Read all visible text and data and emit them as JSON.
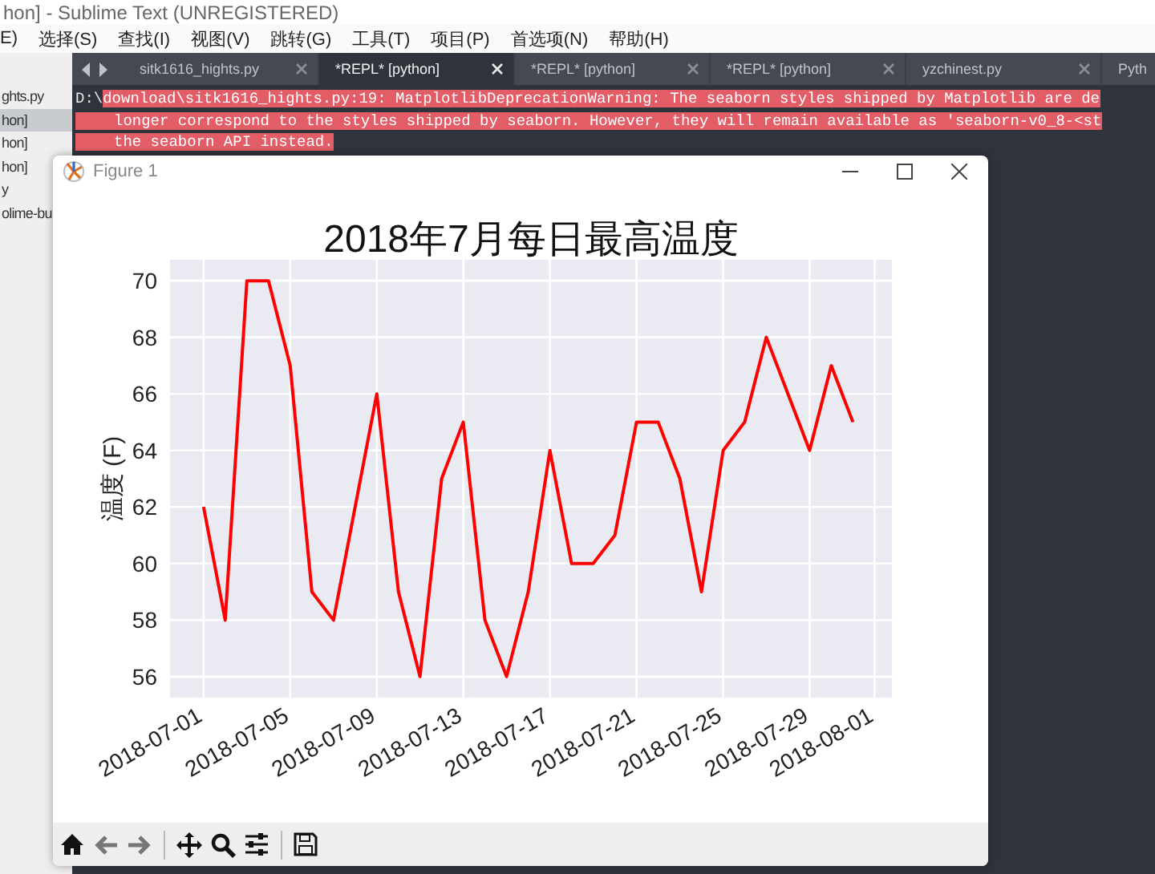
{
  "window": {
    "title": "hon] - Sublime Text (UNREGISTERED)"
  },
  "menu": [
    "E)",
    "选择(S)",
    "查找(I)",
    "视图(V)",
    "跳转(G)",
    "工具(T)",
    "项目(P)",
    "首选项(N)",
    "帮助(H)"
  ],
  "sidebar": {
    "items": [
      {
        "label": "ghts.py",
        "selected": false
      },
      {
        "label": "hon]",
        "selected": true
      },
      {
        "label": "hon]",
        "selected": false
      },
      {
        "label": "hon]",
        "selected": false
      },
      {
        "label": "y",
        "selected": false
      },
      {
        "label": "olime-bu",
        "selected": false
      }
    ]
  },
  "tabs": [
    {
      "label": "sitk1616_hights.py",
      "selected": false
    },
    {
      "label": "*REPL* [python]",
      "selected": true
    },
    {
      "label": "*REPL* [python]",
      "selected": false
    },
    {
      "label": "*REPL* [python]",
      "selected": false
    },
    {
      "label": "yzchinest.py",
      "selected": false
    },
    {
      "label": "Pyth",
      "selected": false
    }
  ],
  "console": {
    "prefix": "D:\\",
    "lines": [
      "download\\sitk1616_hights.py:19: MatplotlibDeprecationWarning: The seaborn styles shipped by Matplotlib are de",
      "longer correspond to the styles shipped by seaborn. However, they will remain available as 'seaborn-v0_8-<st",
      "the seaborn API instead."
    ]
  },
  "figure": {
    "title": "Figure 1",
    "chart_data": {
      "type": "line",
      "title": "2018年7月每日最高温度",
      "ylabel": "温度 (F)",
      "categories": [
        "2018-07-01",
        null,
        null,
        null,
        "2018-07-05",
        null,
        null,
        null,
        "2018-07-09",
        null,
        null,
        null,
        "2018-07-13",
        null,
        null,
        null,
        "2018-07-17",
        null,
        null,
        null,
        "2018-07-21",
        null,
        null,
        null,
        "2018-07-25",
        null,
        null,
        null,
        "2018-07-29",
        null,
        null,
        "2018-08-01"
      ],
      "series": [
        {
          "color": "#ff0000",
          "values": [
            62,
            58,
            70,
            70,
            67,
            59,
            58,
            62,
            66,
            59,
            56,
            63,
            65,
            58,
            56,
            59,
            64,
            60,
            60,
            61,
            65,
            65,
            63,
            59,
            64,
            65,
            68,
            66,
            64,
            67,
            65,
            null
          ]
        }
      ],
      "ylim": [
        55.26,
        70.74
      ],
      "grid": true,
      "yticks": [
        56,
        58,
        60,
        62,
        64,
        66,
        68,
        70
      ]
    }
  }
}
